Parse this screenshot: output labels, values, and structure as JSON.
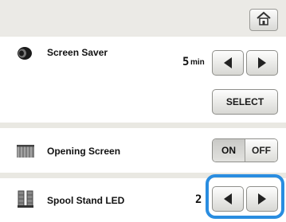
{
  "header": {
    "home_icon": "home-icon"
  },
  "screen_saver": {
    "label": "Screen Saver",
    "icon": "eye-icon",
    "value": "5",
    "unit": "min",
    "decrease_icon": "left-arrow-icon",
    "increase_icon": "right-arrow-icon",
    "select_label": "SELECT"
  },
  "opening_screen": {
    "label": "Opening Screen",
    "icon": "curtain-icon",
    "on_label": "ON",
    "off_label": "OFF",
    "state": "ON"
  },
  "spool_stand_led": {
    "label": "Spool Stand LED",
    "icon": "spool-icon",
    "value": "2",
    "decrease_icon": "left-arrow-icon",
    "increase_icon": "right-arrow-icon",
    "highlight_color": "#2a8de0"
  }
}
